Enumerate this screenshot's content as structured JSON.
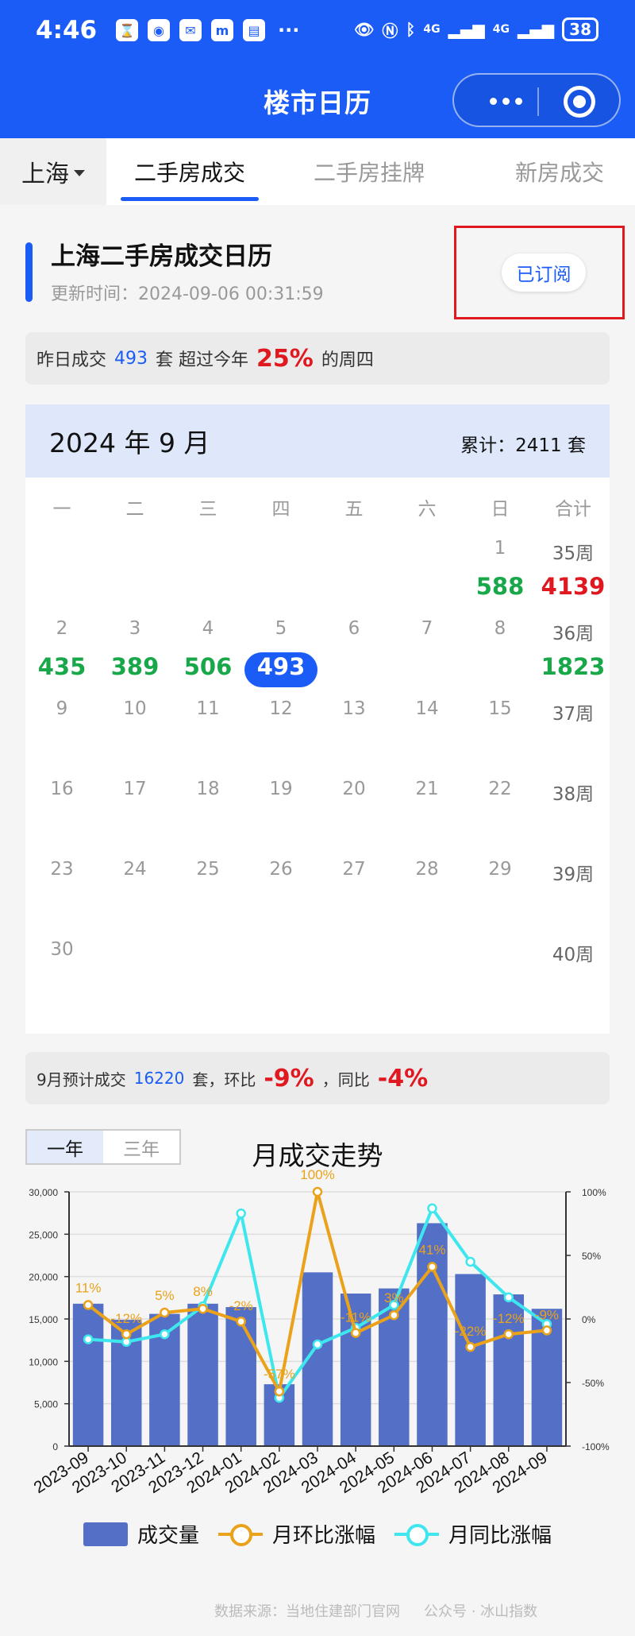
{
  "status_bar": {
    "time": "4:46",
    "apps": [
      "⌛",
      "◉",
      "✉",
      "m",
      "▤"
    ],
    "more": "···",
    "icons": [
      "eye-icon",
      "nfc-icon",
      "bluetooth-icon"
    ],
    "signal_labels": [
      "4G",
      "4G"
    ],
    "battery": "38"
  },
  "nav": {
    "title": "楼市日历"
  },
  "tabs": {
    "city": "上海",
    "items": [
      "二手房成交",
      "二手房挂牌",
      "新房成交"
    ]
  },
  "title_card": {
    "title": "上海二手房成交日历",
    "update_time": "更新时间：2024-09-06 00:31:59",
    "subscribe_label": "已订阅"
  },
  "summary": {
    "prefix": "昨日成交",
    "count": "493",
    "mid": "套 超过今年",
    "percent": "25%",
    "suffix": "的周四"
  },
  "calendar": {
    "month": "2024 年 9 月",
    "total": "累计：2411 套",
    "weekdays": [
      "一",
      "二",
      "三",
      "四",
      "五",
      "六",
      "日",
      "合计"
    ],
    "weeks": [
      {
        "days": [
          "",
          "",
          "",
          "",
          "",
          "",
          "1"
        ],
        "values": [
          "",
          "",
          "",
          "",
          "",
          "",
          "588"
        ],
        "label": "35周",
        "total": "4139"
      },
      {
        "days": [
          "2",
          "3",
          "4",
          "5",
          "6",
          "7",
          "8"
        ],
        "values": [
          "435",
          "389",
          "506",
          "493",
          "",
          "",
          ""
        ],
        "label": "36周",
        "total": "1823"
      },
      {
        "days": [
          "9",
          "10",
          "11",
          "12",
          "13",
          "14",
          "15"
        ],
        "values": [
          "",
          "",
          "",
          "",
          "",
          "",
          ""
        ],
        "label": "37周",
        "total": ""
      },
      {
        "days": [
          "16",
          "17",
          "18",
          "19",
          "20",
          "21",
          "22"
        ],
        "values": [
          "",
          "",
          "",
          "",
          "",
          "",
          ""
        ],
        "label": "38周",
        "total": ""
      },
      {
        "days": [
          "23",
          "24",
          "25",
          "26",
          "27",
          "28",
          "29"
        ],
        "values": [
          "",
          "",
          "",
          "",
          "",
          "",
          ""
        ],
        "label": "39周",
        "total": ""
      },
      {
        "days": [
          "30",
          "",
          "",
          "",
          "",
          "",
          ""
        ],
        "values": [
          "",
          "",
          "",
          "",
          "",
          "",
          ""
        ],
        "label": "40周",
        "total": ""
      }
    ],
    "selected_value": "493"
  },
  "forecast": {
    "prefix": "9月预计成交",
    "count": "16220",
    "mid": "套，环比",
    "mom": "-9%",
    "sep": "，同比",
    "yoy": "-4%"
  },
  "range_tabs": [
    "一年",
    "三年"
  ],
  "chart_title": "月成交走势",
  "chart_data": {
    "type": "bar",
    "categories": [
      "2023-09",
      "2023-10",
      "2023-11",
      "2023-12",
      "2024-01",
      "2024-02",
      "2024-03",
      "2024-04",
      "2024-05",
      "2024-06",
      "2024-07",
      "2024-08",
      "2024-09"
    ],
    "series": [
      {
        "name": "成交量",
        "type": "bar",
        "axis": "left",
        "values": [
          16800,
          14900,
          15600,
          16800,
          16400,
          7300,
          20500,
          18000,
          18600,
          26300,
          20300,
          17900,
          16200
        ]
      },
      {
        "name": "月环比涨幅",
        "type": "line",
        "axis": "right",
        "values": [
          11,
          -12,
          5,
          8,
          -2,
          -57,
          100,
          -11,
          3,
          41,
          -22,
          -12,
          -9
        ],
        "labels": [
          "11%",
          "-12%",
          "5%",
          "8%",
          "-2%",
          "-57%",
          "100%",
          "-11%",
          "3%",
          "41%",
          "-22%",
          "-12%",
          "-9%"
        ]
      },
      {
        "name": "月同比涨幅",
        "type": "line",
        "axis": "right",
        "values": [
          -16,
          -18,
          -12,
          10,
          83,
          -62,
          -20,
          -7,
          11,
          87,
          45,
          17,
          -4
        ]
      }
    ],
    "ylim_left": [
      0,
      30000
    ],
    "ylim_right": [
      -100,
      100
    ],
    "yticks_left": [
      "0",
      "5,000",
      "10,000",
      "15,000",
      "20,000",
      "25,000",
      "30,000"
    ],
    "yticks_right": [
      "-100%",
      "-50%",
      "0%",
      "50%",
      "100%"
    ],
    "grid": true,
    "legend": "bottom",
    "colors": {
      "bar": "#5470c6",
      "mom": "#eaa21b",
      "yoy": "#3ee6ee"
    }
  },
  "footer": {
    "source": "数据来源：当地住建部门官网",
    "account": "公众号 · 冰山指数"
  }
}
